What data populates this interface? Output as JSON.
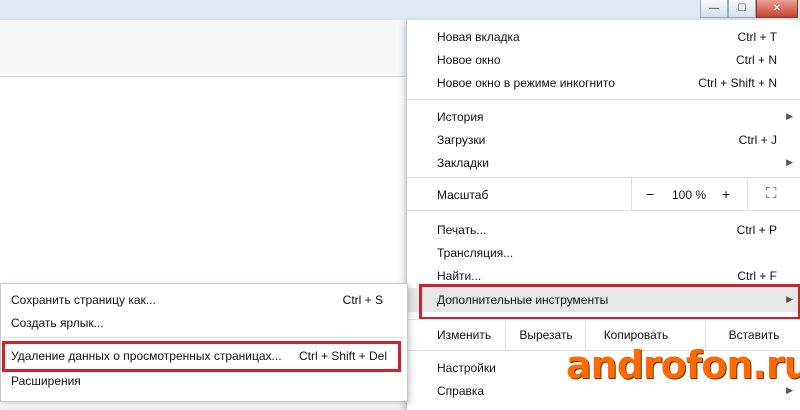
{
  "window_controls": {
    "minimize": "—",
    "maximize": "☐",
    "close": "✕"
  },
  "menu": {
    "new_tab": {
      "label": "Новая вкладка",
      "shortcut": "Ctrl + T"
    },
    "new_window": {
      "label": "Новое окно",
      "shortcut": "Ctrl + N"
    },
    "incognito": {
      "label": "Новое окно в режиме инкогнито",
      "shortcut": "Ctrl + Shift + N"
    },
    "history": {
      "label": "История"
    },
    "downloads": {
      "label": "Загрузки",
      "shortcut": "Ctrl + J"
    },
    "bookmarks": {
      "label": "Закладки"
    },
    "zoom": {
      "label": "Масштаб",
      "minus": "−",
      "value": "100 %",
      "plus": "+",
      "fullscreen": "⛶"
    },
    "print": {
      "label": "Печать...",
      "shortcut": "Ctrl + P"
    },
    "cast": {
      "label": "Трансляция..."
    },
    "find": {
      "label": "Найти...",
      "shortcut": "Ctrl + F"
    },
    "more_tools": {
      "label": "Дополнительные инструменты"
    },
    "edit": {
      "label": "Изменить",
      "cut": "Вырезать",
      "copy": "Копировать",
      "paste": "Вставить"
    },
    "settings": {
      "label": "Настройки"
    },
    "help": {
      "label": "Справка"
    }
  },
  "submenu": {
    "save_page": {
      "label": "Сохранить страницу как...",
      "shortcut": "Ctrl + S"
    },
    "create_shortcut": {
      "label": "Создать ярлык..."
    },
    "clear_data": {
      "label": "Удаление данных о просмотренных страницах...",
      "shortcut": "Ctrl + Shift + Del"
    },
    "extensions": {
      "label": "Расширения"
    }
  },
  "watermark": "androfon.ru",
  "colors": {
    "highlight_box": "#d4202b",
    "watermark": "#ff6a00"
  }
}
